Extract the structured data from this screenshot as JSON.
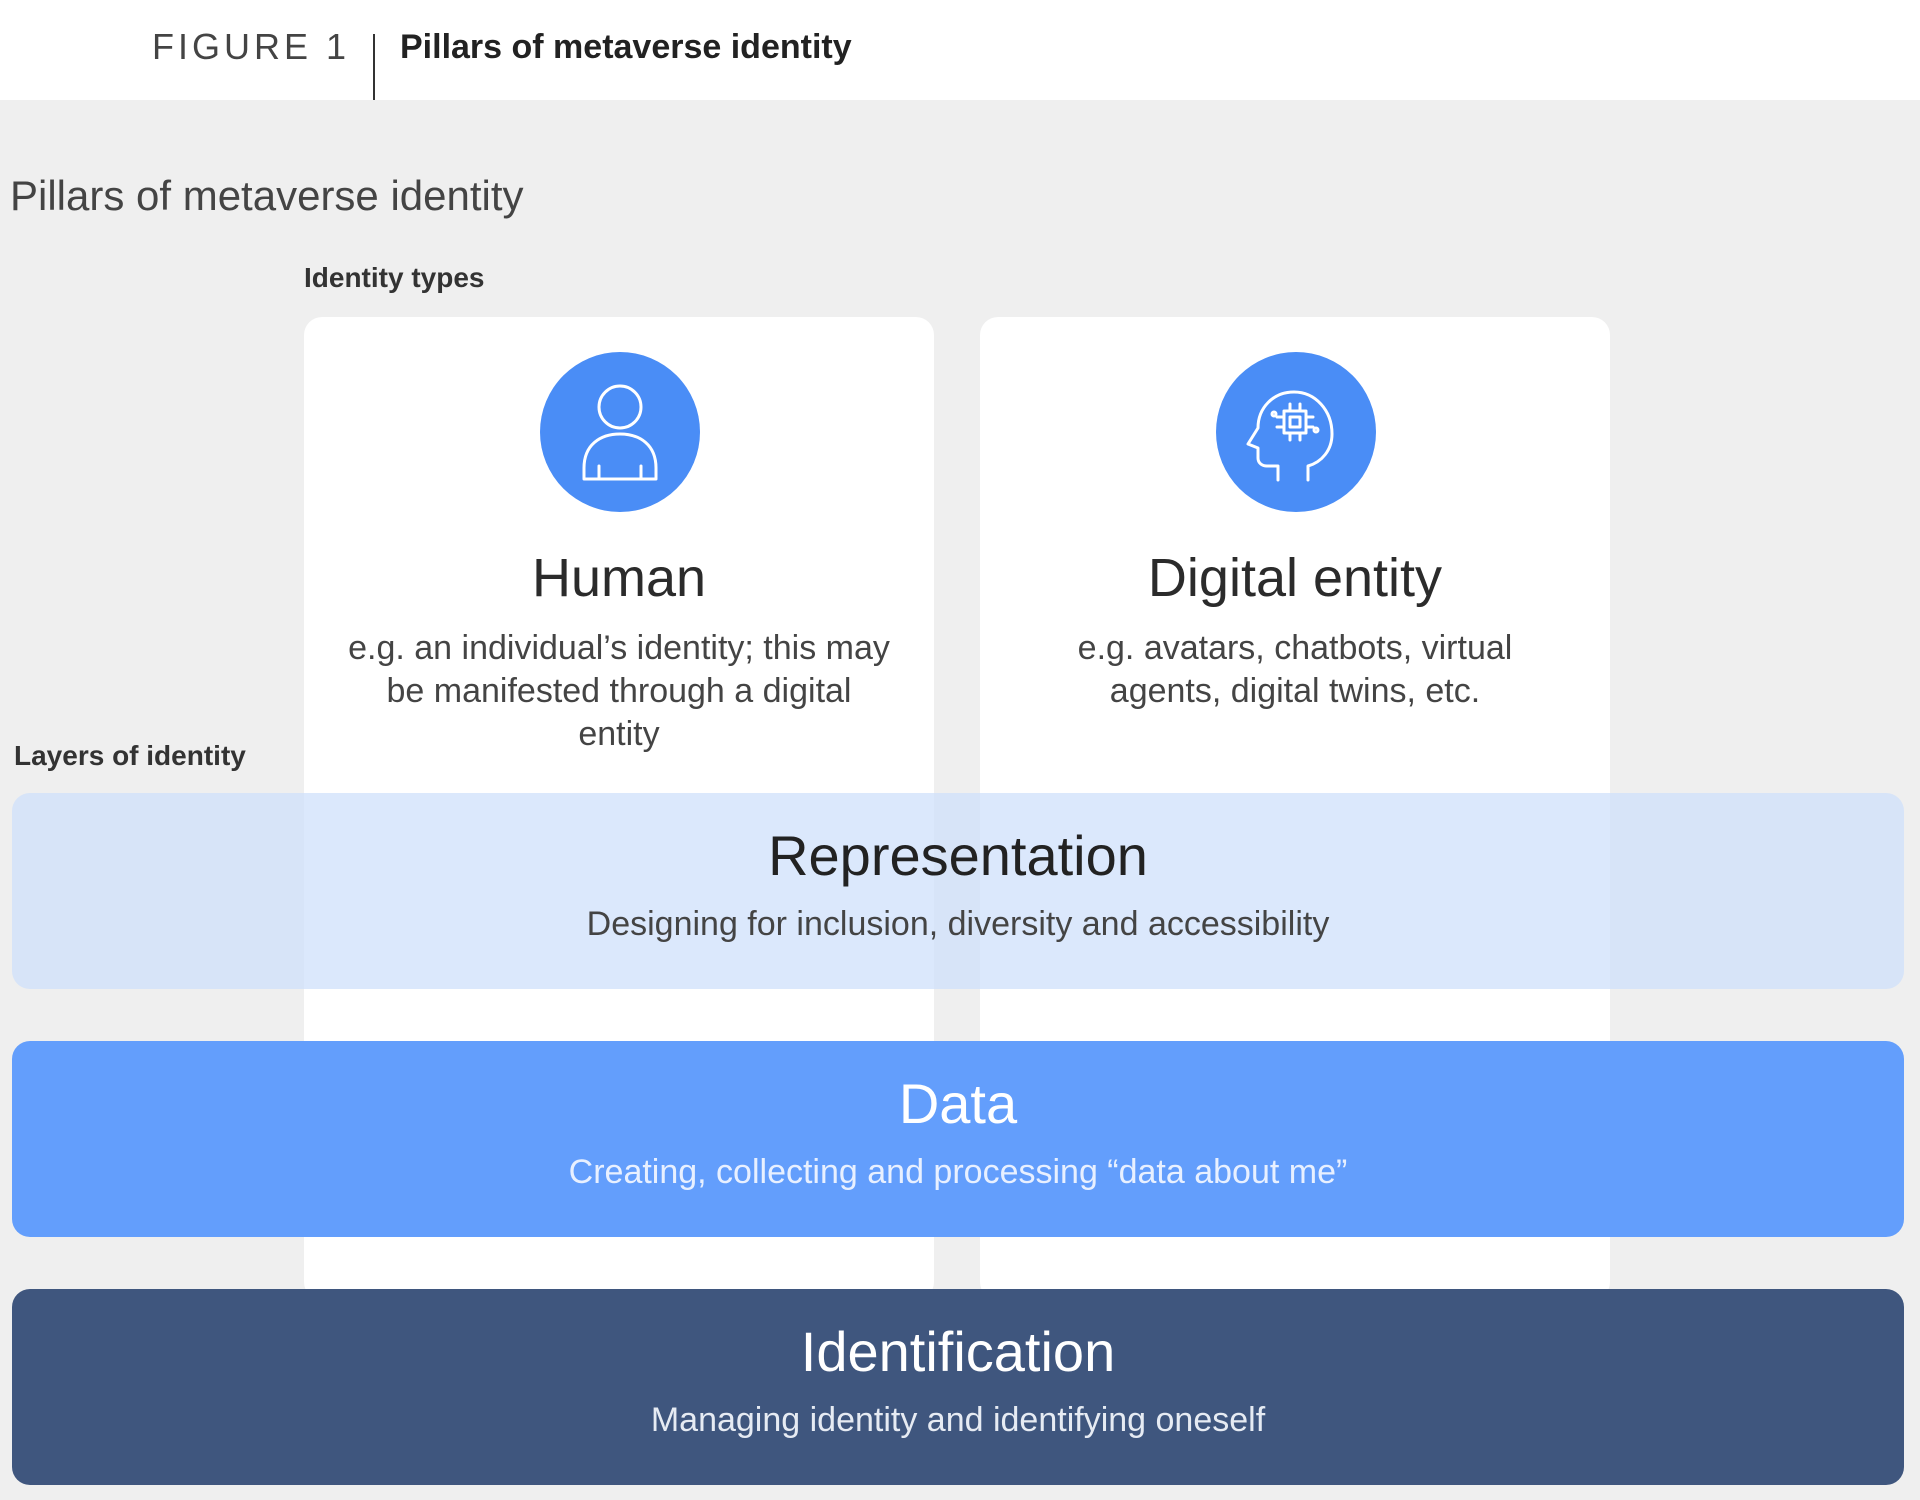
{
  "header": {
    "figure_label": "FIGURE 1",
    "figure_title": "Pillars of metaverse identity"
  },
  "diagram": {
    "title": "Pillars of metaverse identity",
    "identity_types_label": "Identity types",
    "layers_label": "Layers of identity",
    "accent_color": "#4a8df6",
    "identity_types": [
      {
        "icon": "person-icon",
        "title": "Human",
        "description": "e.g. an individual’s identity; this may be manifested through a digital entity"
      },
      {
        "icon": "ai-head-chip-icon",
        "title": "Digital entity",
        "description": "e.g. avatars, chatbots, virtual agents, digital twins, etc."
      }
    ],
    "layers": [
      {
        "name": "Representation",
        "description": "Designing for inclusion, diversity and accessibility",
        "color": "#cddffb"
      },
      {
        "name": "Data",
        "description": "Creating, collecting and processing “data about me”",
        "color": "#639efc"
      },
      {
        "name": "Identification",
        "description": "Managing identity and identifying oneself",
        "color": "#3f567e"
      }
    ]
  }
}
